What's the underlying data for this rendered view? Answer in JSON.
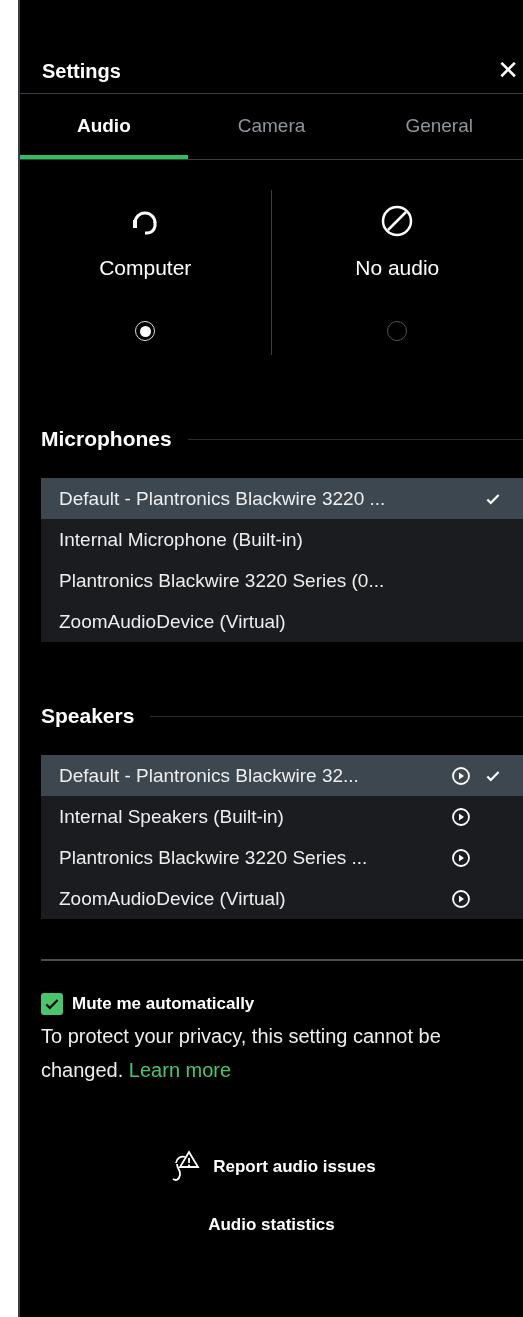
{
  "header": {
    "title": "Settings",
    "close": "✕"
  },
  "tabs": [
    {
      "label": "Audio",
      "selected": true
    },
    {
      "label": "Camera",
      "selected": false
    },
    {
      "label": "General",
      "selected": false
    }
  ],
  "audio_modes": [
    {
      "kind": "headset",
      "label": "Computer",
      "selected": true
    },
    {
      "kind": "none",
      "label": "No audio",
      "selected": false
    }
  ],
  "microphones": {
    "heading": "Microphones",
    "items": [
      {
        "label": "Default - Plantronics Blackwire 3220 ...",
        "selected": true
      },
      {
        "label": "Internal Microphone (Built-in)",
        "selected": false
      },
      {
        "label": "Plantronics Blackwire 3220 Series (0...",
        "selected": false
      },
      {
        "label": "ZoomAudioDevice (Virtual)",
        "selected": false
      }
    ]
  },
  "speakers": {
    "heading": "Speakers",
    "items": [
      {
        "label": "Default - Plantronics Blackwire 32...",
        "selected": true
      },
      {
        "label": "Internal Speakers (Built-in)",
        "selected": false
      },
      {
        "label": "Plantronics Blackwire 3220 Series ...",
        "selected": false
      },
      {
        "label": "ZoomAudioDevice (Virtual)",
        "selected": false
      }
    ]
  },
  "mute": {
    "label": "Mute me automatically",
    "checked": true,
    "note": "To protect your privacy, this setting cannot be changed.",
    "link": "Learn more"
  },
  "actions": [
    {
      "kind": "report",
      "label": "Report audio issues"
    },
    {
      "kind": "plain",
      "label": "Audio statistics"
    }
  ]
}
